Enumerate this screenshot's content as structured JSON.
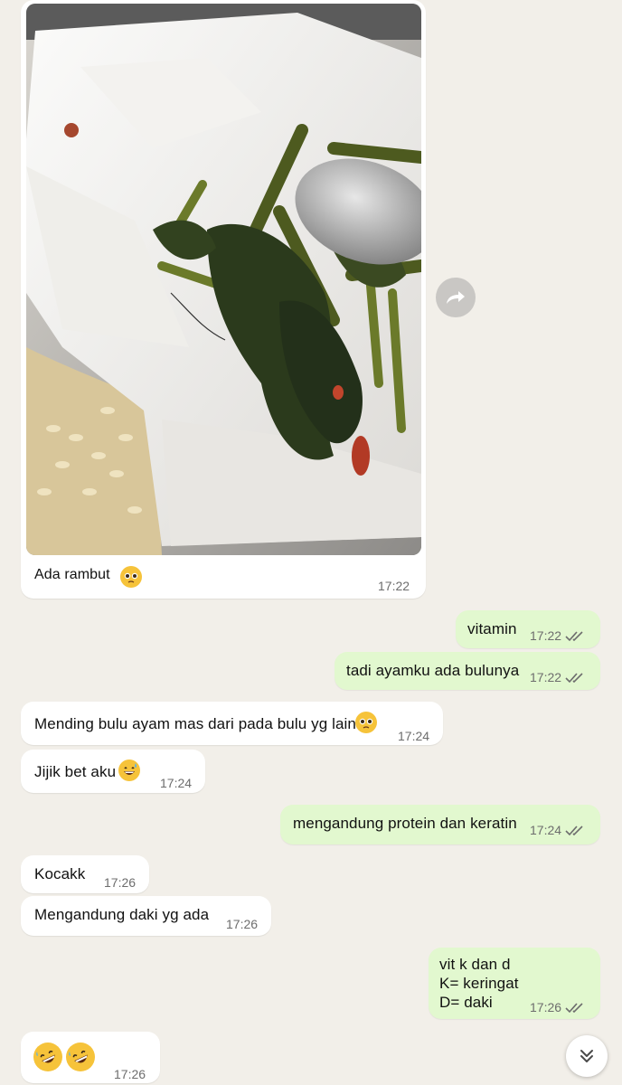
{
  "messages": [
    {
      "type": "incoming",
      "text": "Ada rambut",
      "emoji": "pleading-face",
      "time": "17:22"
    },
    {
      "type": "outgoing",
      "text": "vitamin",
      "time": "17:22",
      "status": "read"
    },
    {
      "type": "outgoing",
      "text": "tadi ayamku ada bulunya",
      "time": "17:22",
      "status": "read"
    },
    {
      "type": "incoming",
      "text": "Mending bulu ayam mas dari pada bulu yg lain",
      "emoji": "pleading-face",
      "time": "17:24"
    },
    {
      "type": "incoming",
      "text": "Jijik bet aku",
      "emoji": "grinning-sweat-face",
      "time": "17:24"
    },
    {
      "type": "outgoing",
      "text": "mengandung protein dan keratin",
      "time": "17:24",
      "status": "read"
    },
    {
      "type": "incoming",
      "text": "Kocakk",
      "time": "17:26"
    },
    {
      "type": "incoming",
      "text": "Mengandung daki yg ada",
      "time": "17:26"
    },
    {
      "type": "outgoing",
      "text": "vit k dan d\nK= keringat\nD= daki",
      "time": "17:26",
      "status": "read"
    },
    {
      "type": "incoming",
      "text": "",
      "emoji": "rolling-on-floor-laughing-x2",
      "time": "17:26"
    }
  ],
  "icons": {
    "forward": "forward-arrow-icon",
    "scroll_down": "double-chevron-down-icon",
    "read_receipt": "double-check-icon"
  },
  "colors": {
    "chat_background": "#f2efe9",
    "incoming_bubble": "#ffffff",
    "outgoing_bubble": "#e2f8cf",
    "read_tick": "#6d6d6d"
  }
}
